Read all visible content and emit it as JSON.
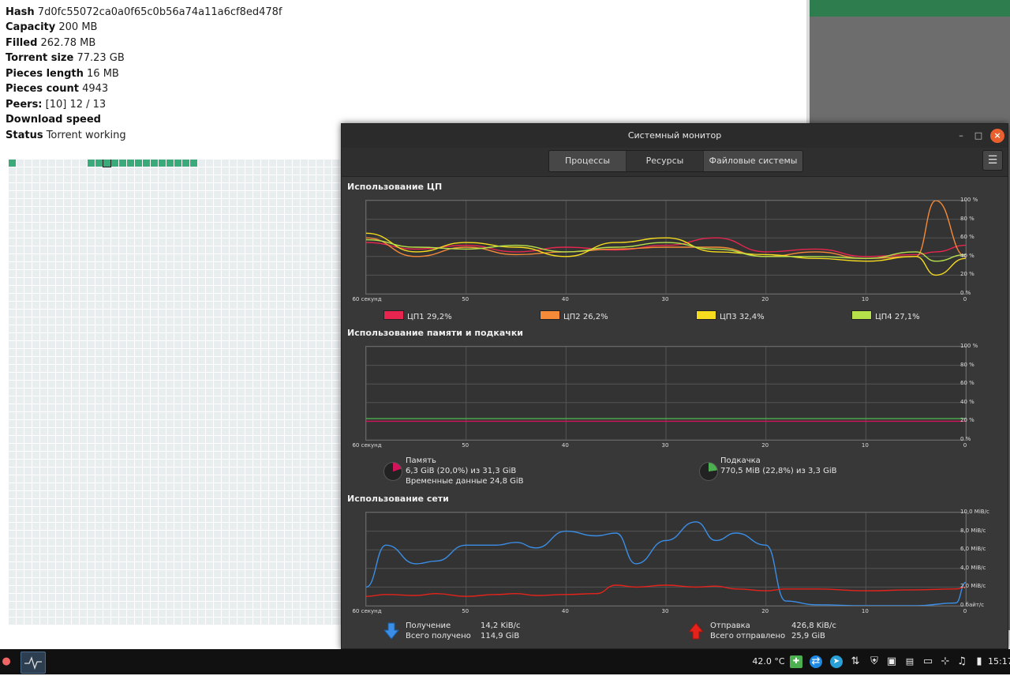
{
  "torrent": {
    "hash_label": "Hash",
    "hash": "7d0fc55072ca0a0f65c0b56a74a11a6cf8ed478f",
    "capacity_label": "Capacity",
    "capacity": "200 MB",
    "filled_label": "Filled",
    "filled": "262.78 MB",
    "size_label": "Torrent size",
    "size": "77.23 GB",
    "plength_label": "Pieces length",
    "plength": "16 MB",
    "pcount_label": "Pieces count",
    "pcount": "4943",
    "peers_label": "Peers:",
    "peers": "[10] 12 / 13",
    "speed_label": "Download speed",
    "speed": "",
    "status_label": "Status",
    "status": "Torrent working"
  },
  "monitor": {
    "title": "Системный монитор",
    "tabs": [
      {
        "label": "Процессы"
      },
      {
        "label": "Ресурсы"
      },
      {
        "label": "Файловые системы"
      }
    ],
    "menu_icon": "hamburger-icon",
    "cpu_title": "Использование ЦП",
    "mem_title": "Использование памяти и подкачки",
    "net_title": "Использование сети",
    "x_ticks": [
      "60 секунд",
      "50",
      "40",
      "30",
      "20",
      "10",
      "0"
    ],
    "cpu_y_ticks": [
      "100 %",
      "80 %",
      "60 %",
      "40 %",
      "20 %",
      "0 %"
    ],
    "mem_y_ticks": [
      "100 %",
      "80 %",
      "60 %",
      "40 %",
      "20 %",
      "0 %"
    ],
    "net_y_ticks": [
      "10,0 MiB/c",
      "8,0 MiB/c",
      "6,0 MiB/c",
      "4,0 MiB/c",
      "2,0 MiB/c",
      "0 байт/с"
    ],
    "cpu_legend": [
      {
        "name": "ЦП1",
        "value": "29,2%",
        "color": "#e8254f"
      },
      {
        "name": "ЦП2",
        "value": "26,2%",
        "color": "#f58a38"
      },
      {
        "name": "ЦП3",
        "value": "32,4%",
        "color": "#f5dc1e"
      },
      {
        "name": "ЦП4",
        "value": "27,1%",
        "color": "#b6e04a"
      }
    ],
    "memory": {
      "label": "Память",
      "usage": "6,3 GiB (20,0%) из 31,3 GiB",
      "cache": "Временные данные 24,8 GiB",
      "color": "#d4145a"
    },
    "swap": {
      "label": "Подкачка",
      "usage": "770,5 MiB (22,8%) из 3,3 GiB",
      "color": "#4caf50"
    },
    "net": {
      "recv_label": "Получение",
      "recv_rate": "14,2 KiB/c",
      "recv_total_label": "Всего получено",
      "recv_total": "114,9 GiB",
      "send_label": "Отправка",
      "send_rate": "426,8 KiB/c",
      "send_total_label": "Всего отправлено",
      "send_total": "25,9 GiB",
      "recv_color": "#3a8ee6",
      "send_color": "#e5231b"
    }
  },
  "chart_data": [
    {
      "type": "line",
      "x": [
        60,
        55,
        50,
        45,
        40,
        35,
        30,
        25,
        20,
        15,
        10,
        5,
        3,
        0
      ],
      "ylim": [
        0,
        100
      ],
      "series": [
        {
          "name": "ЦП1",
          "values": [
            55,
            48,
            52,
            45,
            50,
            47,
            52,
            60,
            45,
            48,
            40,
            42,
            45,
            52
          ]
        },
        {
          "name": "ЦП2",
          "values": [
            60,
            40,
            50,
            42,
            45,
            48,
            50,
            50,
            40,
            45,
            38,
            40,
            100,
            40
          ]
        },
        {
          "name": "ЦП3",
          "values": [
            65,
            45,
            55,
            50,
            40,
            55,
            60,
            45,
            42,
            38,
            35,
            40,
            20,
            38
          ]
        },
        {
          "name": "ЦП4",
          "values": [
            58,
            50,
            48,
            52,
            45,
            50,
            55,
            48,
            40,
            40,
            38,
            45,
            35,
            42
          ]
        }
      ]
    },
    {
      "type": "line",
      "x": [
        60,
        0
      ],
      "ylim": [
        0,
        100
      ],
      "series": [
        {
          "name": "Память",
          "values": [
            20,
            20
          ]
        },
        {
          "name": "Подкачка",
          "values": [
            22.8,
            22.8
          ]
        }
      ]
    },
    {
      "type": "line",
      "x": [
        60,
        58,
        55,
        53,
        50,
        47,
        45,
        43,
        40,
        37,
        35,
        33,
        30,
        27,
        25,
        23,
        20,
        18,
        15,
        10,
        5,
        1,
        0
      ],
      "ylim": [
        0,
        10
      ],
      "series": [
        {
          "name": "Получение",
          "values": [
            2,
            6.5,
            4.5,
            4.8,
            6.5,
            6.5,
            6.8,
            6.2,
            8,
            7.5,
            7.8,
            4.5,
            7,
            9,
            7,
            7.8,
            6.5,
            0.5,
            0.1,
            0,
            0,
            0.3,
            2.5
          ]
        },
        {
          "name": "Отправка",
          "values": [
            1,
            1.2,
            1.1,
            1.3,
            1.0,
            1.2,
            1.3,
            1.1,
            1.2,
            1.3,
            2.2,
            2.0,
            2.2,
            2.0,
            2.1,
            1.8,
            1.6,
            1.8,
            1.8,
            1.6,
            1.7,
            1.8,
            2.0
          ]
        }
      ]
    }
  ],
  "taskbar": {
    "temperature": "42.0 °C",
    "clock": "15:17"
  }
}
